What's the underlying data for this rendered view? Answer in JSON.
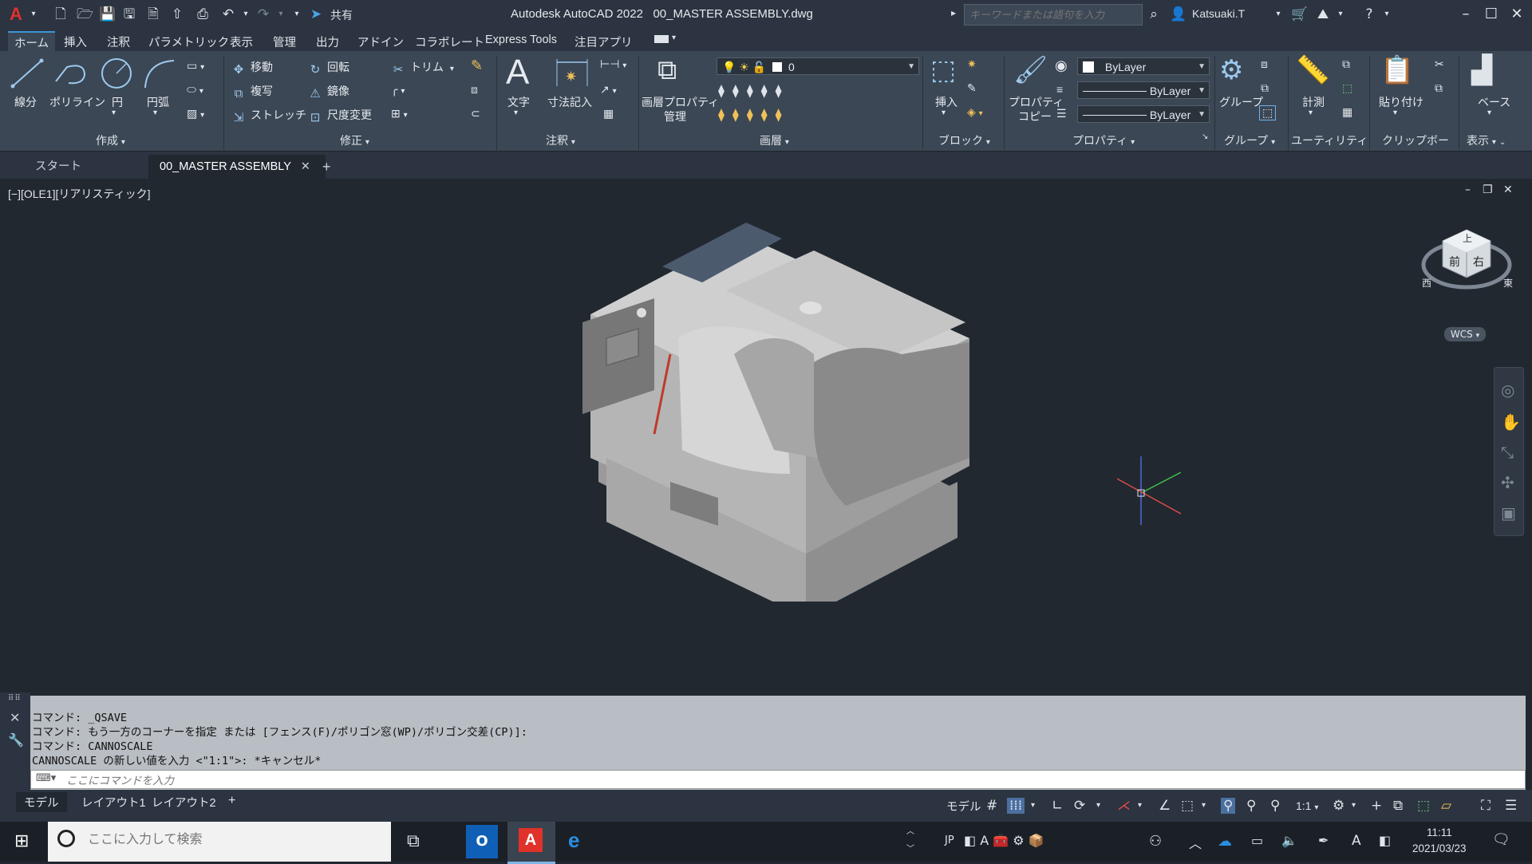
{
  "titlebar": {
    "app_logo": "A",
    "share_label": "共有",
    "app_title": "Autodesk AutoCAD 2022",
    "file_name": "00_MASTER ASSEMBLY.dwg",
    "search_placeholder": "キーワードまたは語句を入力",
    "user": "Katsuaki.T"
  },
  "menu": [
    "ホーム",
    "挿入",
    "注釈",
    "パラメトリック",
    "表示",
    "管理",
    "出力",
    "アドイン",
    "コラボレート",
    "Express Tools",
    "注目アプリ"
  ],
  "ribbon": {
    "draw": {
      "line": "線分",
      "polyline": "ポリライン",
      "circle": "円",
      "arc": "円弧",
      "label": "作成"
    },
    "modify": {
      "move": "移動",
      "rotate": "回転",
      "trim": "トリム",
      "copy": "複写",
      "mirror": "鏡像",
      "stretch": "ストレッチ",
      "scale": "尺度変更",
      "label": "修正"
    },
    "annotation": {
      "text": "文字",
      "dimension": "寸法記入",
      "label": "注釈"
    },
    "layers": {
      "properties_line1": "画層プロパティ",
      "properties_line2": "管理",
      "current_layer": "0",
      "label": "画層"
    },
    "block": {
      "insert": "挿入",
      "label": "ブロック"
    },
    "properties": {
      "match_line1": "プロパティ",
      "match_line2": "コピー",
      "color": "ByLayer",
      "linetype": "ByLayer",
      "lineweight": "ByLayer",
      "label": "プロパティ"
    },
    "groups": {
      "group": "グループ",
      "label": "グループ"
    },
    "utilities": {
      "measure": "計測",
      "label": "ユーティリティ"
    },
    "clipboard": {
      "paste": "貼り付け",
      "label": "クリップボード"
    },
    "view": {
      "base": "ベース",
      "label": "表示"
    }
  },
  "doc_tabs": {
    "start": "スタート",
    "active": "00_MASTER ASSEMBLY"
  },
  "viewport": {
    "label": "[−][OLE1][リアリスティック]",
    "viewcube_top": "上",
    "viewcube_front": "前",
    "viewcube_right": "右",
    "viewcube_west": "西",
    "viewcube_east": "東",
    "wcs": "WCS"
  },
  "command": {
    "history": [
      "コマンド: _QSAVE",
      "コマンド: もう一方のコーナーを指定 または [フェンス(F)/ポリゴン窓(WP)/ポリゴン交差(CP)]:",
      "コマンド: CANNOSCALE",
      "CANNOSCALE の新しい値を入力 <\"1:1\">: *キャンセル*"
    ],
    "placeholder": "ここにコマンドを入力"
  },
  "layout_tabs": [
    "モデル",
    "レイアウト1",
    "レイアウト2"
  ],
  "status": {
    "model": "モデル",
    "scale": "1:1"
  },
  "taskbar": {
    "search_placeholder": "ここに入力して検索",
    "ime": "JP",
    "ime_mode": "A",
    "time": "11:11",
    "date": "2021/03/23"
  },
  "colors": {
    "titlebar": "#2b3440",
    "ribbon": "#3b4755",
    "viewport": "#212830",
    "accent": "#3b96d6",
    "autocad_red": "#e0322b"
  }
}
